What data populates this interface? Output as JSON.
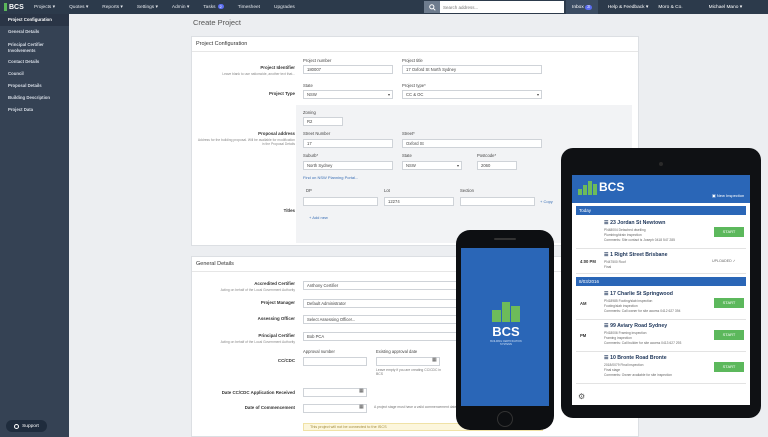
{
  "topbar": {
    "logo": "BCS",
    "menu": [
      {
        "label": "Projects ▾"
      },
      {
        "label": "Quotes ▾"
      },
      {
        "label": "Reports ▾"
      },
      {
        "label": "Settings ▾"
      },
      {
        "label": "Admin ▾"
      },
      {
        "label": "Tasks",
        "badge": "2"
      },
      {
        "label": "Timesheet"
      },
      {
        "label": "Upgrades"
      }
    ],
    "search_placeholder": "Search address...",
    "inbox": "Inbox",
    "inbox_badge": "3",
    "help": "Help & Feedback ▾",
    "company": "Moro & Co.",
    "user": "Michael Mano ▾"
  },
  "sidebar": [
    {
      "label": "Project Configuration"
    },
    {
      "label": "General Details"
    },
    {
      "label": "Principal Certifier Involvements"
    },
    {
      "label": "Contact Details"
    },
    {
      "label": "Council"
    },
    {
      "label": "Proposal Details"
    },
    {
      "label": "Building Description"
    },
    {
      "label": "Project Data"
    }
  ],
  "page_title": "Create Project",
  "config": {
    "title": "Project Configuration",
    "identifier_label": "Project Identifier",
    "identifier_sub": "Leave blank to use nationwide, another text that...",
    "project_number_label": "Project number",
    "project_number": "180007",
    "project_title_label": "Project title",
    "project_title": "17 Oxford St North Sydney",
    "type_label": "Project Type",
    "state_label": "State",
    "state": "NSW",
    "type_sub_label": "Project type*",
    "type": "CC & OC",
    "address_label": "Proposal address",
    "address_sub": "Address for the building proposal. Will be available for modification in the Proposal Details",
    "zoning_label": "Zoning",
    "zoning": "R2",
    "street_number_label": "Street Number",
    "street_number": "17",
    "street_label": "Street*",
    "street": "Oxford St",
    "suburb_label": "Suburb*",
    "suburb": "North Sydney",
    "state2_label": "State",
    "state2": "NSW",
    "postcode_label": "Postcode*",
    "postcode": "2060",
    "portal_link": "Find on NSW Planning Portal...",
    "titles_label": "Titles",
    "dp_label": "DP",
    "lot_label": "Lot",
    "section_label": "Section",
    "lot": "12274",
    "copy_link": "Copy",
    "add_new": "Add new"
  },
  "general": {
    "title": "General Details",
    "accredited_label": "Accredited Certifier",
    "accredited_sub": "Acting on behalf of the Local Government Authority",
    "accredited": "Anthony Certifier",
    "manager_label": "Project Manager",
    "manager": "Default Administrator",
    "officer_label": "Assessing Officer",
    "officer": "Select Assessing Officer...",
    "principal_label": "Principal Certifier",
    "principal_sub": "Acting on behalf of the Local Government Authority",
    "principal": "Bob PCA",
    "ccdc_label": "CC/CDC",
    "approval_number_label": "Approval number",
    "existing_date_label": "Existing approval date",
    "ccdc_hint": "Leave empty if you are creating CC/CDC in BCS",
    "app_received_label": "Date CC/CDC Application Received",
    "commencement_label": "Date of Commencement",
    "commencement_hint": "A project stage must have a valid commencement date",
    "warning": "This project will not be connected to the ISCS"
  },
  "support": "Support",
  "phone": {
    "logo": "BCS",
    "tagline": "BUILDING CERTIFICATION SYSTEMS"
  },
  "tablet": {
    "logo": "BCS",
    "new_inspection": "New Inspection",
    "day1": "Today",
    "day2": "8/03/2016",
    "jobs": [
      {
        "time": "",
        "title": "23 Jordan St Newtown",
        "l1": "PN48004 Detached dwelling",
        "l2": "Plumbing/drain inspection",
        "l3": "Comments: Site contact is Joseph 0418 547 285",
        "action": "START"
      },
      {
        "time": "4:00 PM",
        "title": "1 Right Street Brisbane",
        "l1": "PN47500 Roof",
        "l2": "Final",
        "l3": "",
        "action": "UPLOADED ✓"
      },
      {
        "time": "AM",
        "title": "17 Charlie St Springwood",
        "l1": "PN18985 Footing/slab inspection",
        "l2": "Footing/slab inspection",
        "l3": "Comments: Call owner for site access 0412 627 394",
        "action": "START"
      },
      {
        "time": "PM",
        "title": "99 Aviary Road Sydney",
        "l1": "PN18006 Framing inspection",
        "l2": "Framing inspection",
        "l3": "Comments: Call builder for site access 0413 627 293",
        "action": "START"
      },
      {
        "time": "",
        "title": "10 Bronte Road Bronte",
        "l1": "2018/0079 Final inspection",
        "l2": "Final stage",
        "l3": "Comments: Owner available for site inspection",
        "action": "START"
      }
    ]
  }
}
